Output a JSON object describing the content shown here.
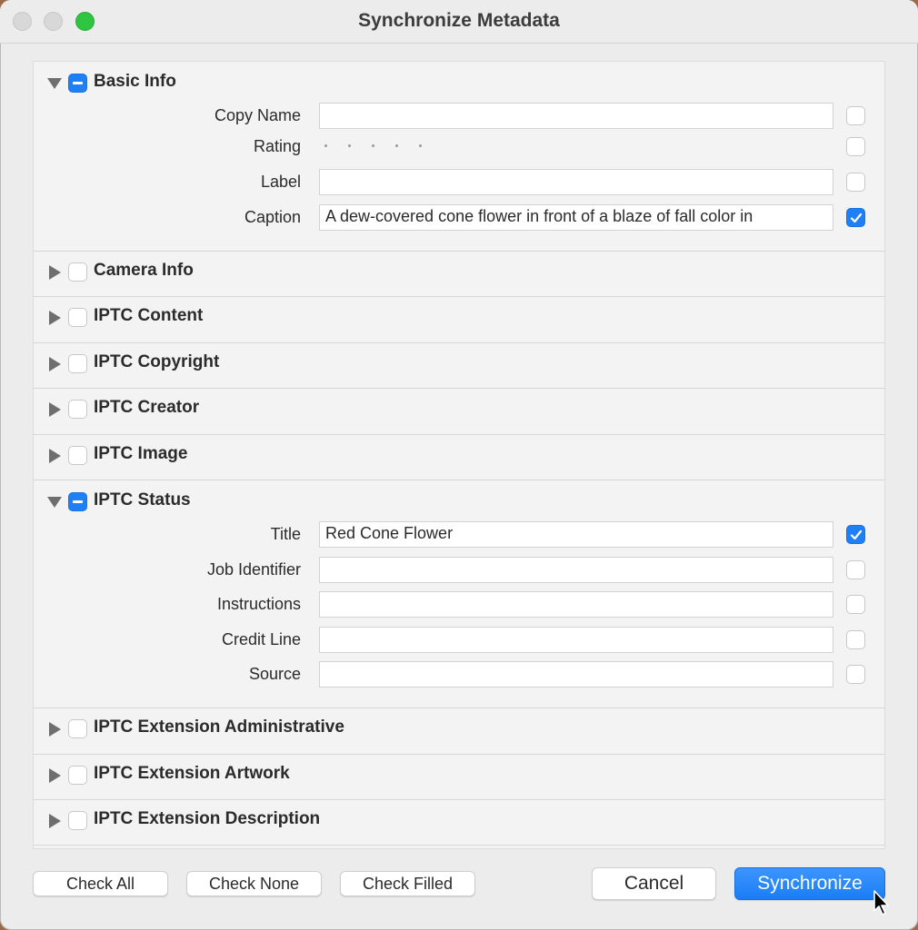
{
  "window": {
    "title": "Synchronize Metadata"
  },
  "groups": {
    "basic_info": {
      "label": "Basic Info",
      "state": "mixed",
      "expanded": true
    },
    "camera_info": {
      "label": "Camera Info",
      "state": "unchecked",
      "expanded": false
    },
    "iptc_content": {
      "label": "IPTC Content",
      "state": "unchecked",
      "expanded": false
    },
    "iptc_copyright": {
      "label": "IPTC Copyright",
      "state": "unchecked",
      "expanded": false
    },
    "iptc_creator": {
      "label": "IPTC Creator",
      "state": "unchecked",
      "expanded": false
    },
    "iptc_image": {
      "label": "IPTC Image",
      "state": "unchecked",
      "expanded": false
    },
    "iptc_status": {
      "label": "IPTC Status",
      "state": "mixed",
      "expanded": true
    },
    "iptc_ext_admin": {
      "label": "IPTC Extension Administrative",
      "state": "unchecked",
      "expanded": false
    },
    "iptc_ext_artwork": {
      "label": "IPTC Extension Artwork",
      "state": "unchecked",
      "expanded": false
    },
    "iptc_ext_description": {
      "label": "IPTC Extension Description",
      "state": "unchecked",
      "expanded": false
    }
  },
  "basic_fields": {
    "copy_name": {
      "label": "Copy Name",
      "value": "",
      "checked": false
    },
    "rating": {
      "label": "Rating",
      "value": 0,
      "checked": false
    },
    "label": {
      "label": "Label",
      "value": "",
      "checked": false
    },
    "caption": {
      "label": "Caption",
      "value": "A dew-covered cone flower in front of a blaze of fall color in",
      "checked": true
    }
  },
  "status_fields": {
    "title": {
      "label": "Title",
      "value": "Red Cone Flower",
      "checked": true
    },
    "job_identifier": {
      "label": "Job Identifier",
      "value": "",
      "checked": false
    },
    "instructions": {
      "label": "Instructions",
      "value": "",
      "checked": false
    },
    "credit_line": {
      "label": "Credit Line",
      "value": "",
      "checked": false
    },
    "source": {
      "label": "Source",
      "value": "",
      "checked": false
    }
  },
  "buttons": {
    "check_all": "Check All",
    "check_none": "Check None",
    "check_filled": "Check Filled",
    "cancel": "Cancel",
    "synchronize": "Synchronize"
  },
  "colors": {
    "accent": "#1f7ff5",
    "zoom": "#2ec541"
  },
  "icons": {
    "disclosure_open": "triangle-down-icon",
    "disclosure_closed": "triangle-right-icon",
    "checkmark": "checkmark-icon",
    "cursor": "arrow-cursor-icon"
  }
}
